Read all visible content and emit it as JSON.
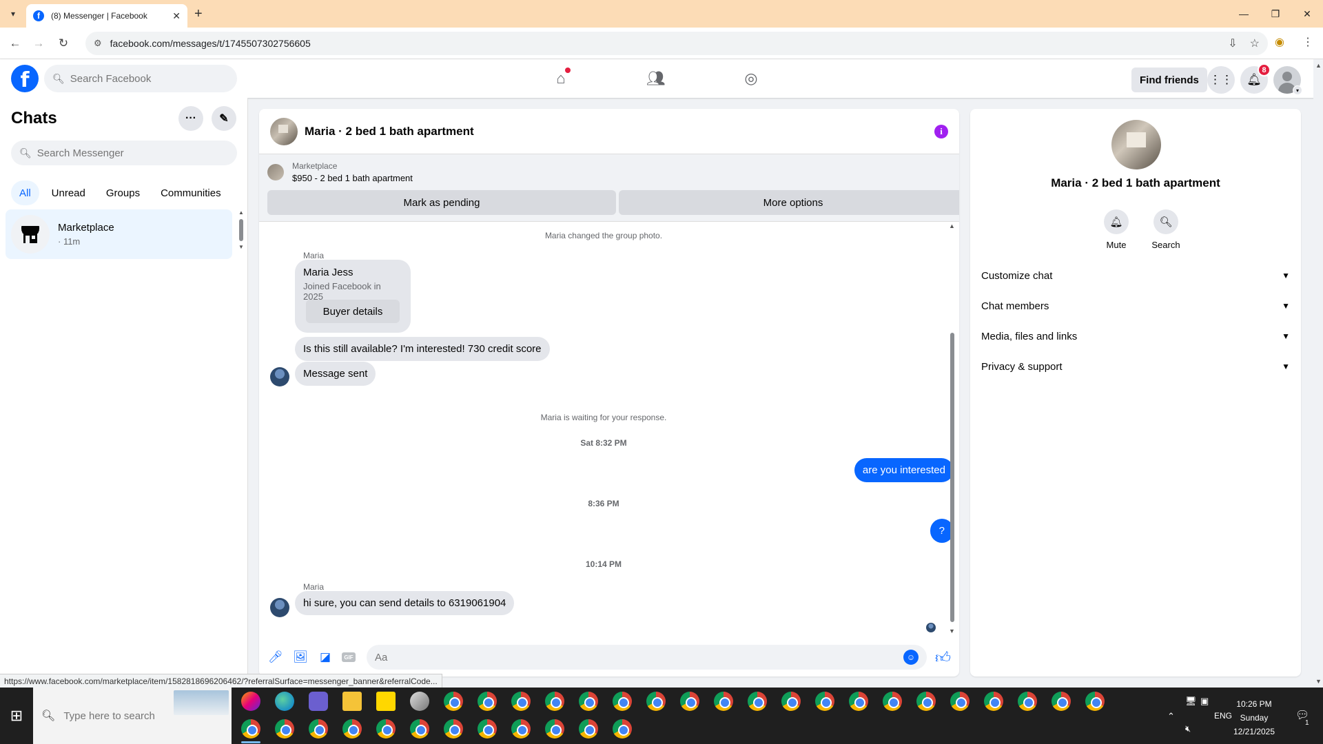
{
  "browser": {
    "tab_title": "(8) Messenger | Facebook",
    "url": "facebook.com/messages/t/1745507302756605",
    "status_url": "https://www.facebook.com/marketplace/item/1582818696206462/?referralSurface=messenger_banner&referralCode..."
  },
  "header": {
    "search_placeholder": "Search Facebook",
    "find_friends": "Find friends",
    "notification_count": "8"
  },
  "sidebar": {
    "title": "Chats",
    "search_placeholder": "Search Messenger",
    "filters": [
      "All",
      "Unread",
      "Groups",
      "Communities"
    ],
    "chat": {
      "name": "Marketplace",
      "time": "· 11m"
    }
  },
  "conversation": {
    "title": "Maria · 2 bed 1 bath apartment",
    "banner": {
      "label": "Marketplace",
      "listing": "$950 - 2 bed 1 bath apartment",
      "mark_pending": "Mark as pending",
      "more_options": "More options"
    },
    "messages": {
      "sys_group_photo": "Maria changed the group photo.",
      "sender1": "Maria",
      "card_name": "Maria Jess",
      "card_joined": "Joined Facebook in 2025",
      "card_button": "Buyer details",
      "msg_interested": "Is this still available? I'm interested! 730 credit score",
      "msg_sent": "Message sent",
      "sys_waiting": "Maria is waiting for your response.",
      "ts1": "Sat 8:32 PM",
      "out1": "are you interested",
      "ts2": "8:36 PM",
      "out2": "?",
      "ts3": "10:14 PM",
      "sender2": "Maria",
      "msg_reply": "hi sure, you can send details to 6319061904"
    },
    "composer_placeholder": "Aa"
  },
  "right_panel": {
    "title": "Maria · 2 bed 1 bath apartment",
    "mute": "Mute",
    "search": "Search",
    "sections": [
      "Customize chat",
      "Chat members",
      "Media, files and links",
      "Privacy & support"
    ]
  },
  "taskbar": {
    "search_placeholder": "Type here to search",
    "time": "10:26 PM",
    "day": "Sunday",
    "date": "12/21/2025",
    "lang": "ENG",
    "notif_count": "1"
  }
}
